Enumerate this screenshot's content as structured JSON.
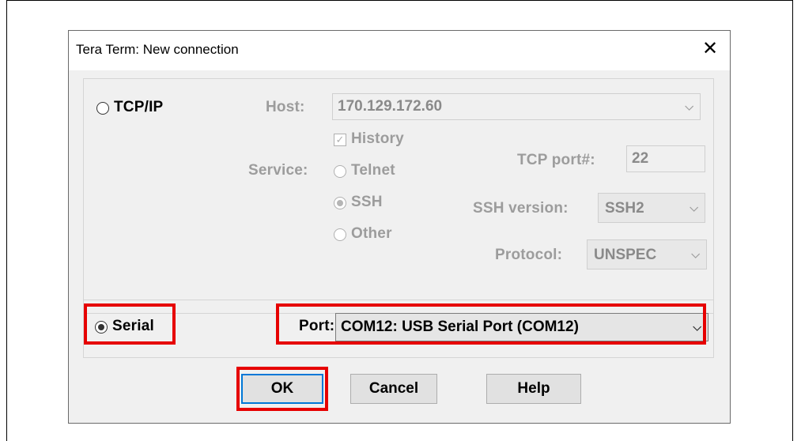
{
  "window": {
    "title": "Tera Term: New connection",
    "close_icon": "close-icon"
  },
  "tcpip": {
    "label": "TCP/IP",
    "host_label": "Host:",
    "host_value": "170.129.172.60",
    "history_label": "History",
    "history_checked": true,
    "service_label": "Service:",
    "services": [
      "Telnet",
      "SSH",
      "Other"
    ],
    "selected_service": "SSH",
    "tcp_port_label": "TCP port#:",
    "tcp_port_value": "22",
    "ssh_version_label": "SSH version:",
    "ssh_version_value": "SSH2",
    "protocol_label": "Protocol:",
    "protocol_value": "UNSPEC"
  },
  "serial": {
    "label": "Serial",
    "port_label": "Port:",
    "port_value": "COM12: USB Serial Port (COM12)"
  },
  "buttons": {
    "ok": "OK",
    "cancel": "Cancel",
    "help": "Help"
  },
  "colors": {
    "highlight": "#e60000",
    "focus": "#0078d7"
  }
}
